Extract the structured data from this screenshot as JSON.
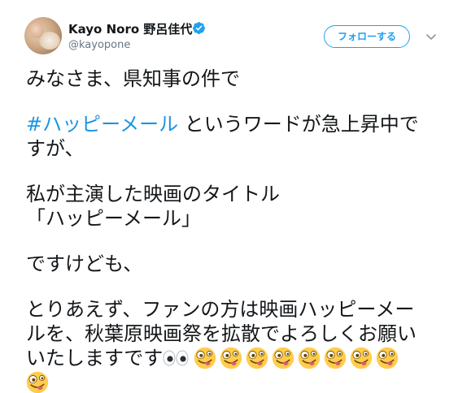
{
  "user": {
    "name": "Kayo Noro 野呂佳代",
    "handle": "@kayopone"
  },
  "follow_button": {
    "label": "フォローする"
  },
  "tweet": {
    "line1": "みなさま、県知事の件で",
    "hashtag": "#ハッピーメール",
    "line2_rest": " というワードが急上昇中で",
    "line3": "すが、",
    "line4": "私が主演した映画のタイトル",
    "line5": "「ハッピーメール」",
    "line6": "ですけども、",
    "line7": "とりあえず、ファンの方は映画ハッピーメー",
    "line8": "ルを、秋葉原映画祭を拡散でよろしくお願い",
    "line9": "いたしますです"
  },
  "icons": {
    "verified": "verified-badge-icon",
    "caret": "chevron-down-icon",
    "eyes": "eyes-emoji",
    "zany": "zany-face-emoji"
  },
  "colors": {
    "accent": "#1da1f2",
    "hashtag": "#1b95e0",
    "text": "#14171a",
    "secondary": "#657786"
  }
}
